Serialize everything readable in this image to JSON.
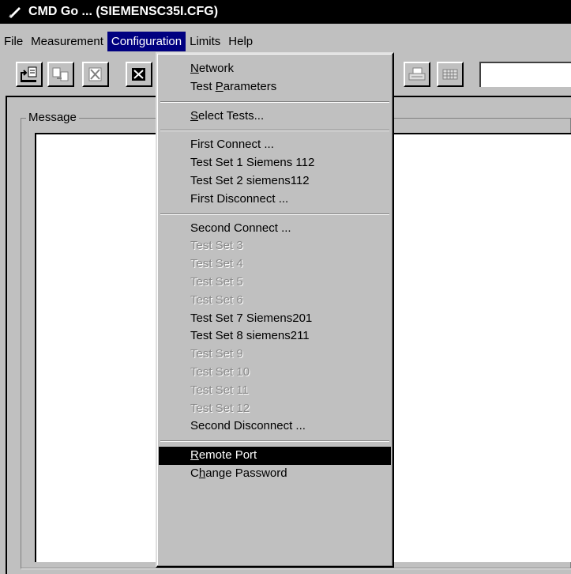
{
  "window": {
    "title": "CMD Go ... (SIEMENSC35I.CFG)"
  },
  "menubar": {
    "items": [
      {
        "label": "File"
      },
      {
        "label": "Measurement"
      },
      {
        "label": "Configuration"
      },
      {
        "label": "Limits"
      },
      {
        "label": "Help"
      }
    ]
  },
  "message_group": {
    "label": "Message"
  },
  "config_menu": {
    "network": {
      "pre": "",
      "key": "N",
      "post": "etwork"
    },
    "test_parameters": {
      "pre": "Test ",
      "key": "P",
      "post": "arameters"
    },
    "select_tests": {
      "pre": "",
      "key": "S",
      "post": "elect Tests..."
    },
    "first_connect": "First Connect  ...",
    "test_set_1": "Test Set  1  Siemens 112",
    "test_set_2": "Test Set  2  siemens112",
    "first_disconnect": "First Disconnect ...",
    "second_connect": "Second Connect ...",
    "test_set_3": "Test Set  3",
    "test_set_4": "Test Set  4",
    "test_set_5": "Test Set  5",
    "test_set_6": "Test Set  6",
    "test_set_7": "Test Set  7  Siemens201",
    "test_set_8": "Test Set  8  siemens211",
    "test_set_9": "Test Set  9",
    "test_set_10": "Test Set 10",
    "test_set_11": "Test Set 11",
    "test_set_12": "Test Set 12",
    "second_disconnect": "Second Disconnect ...",
    "remote_port": {
      "pre": "",
      "key": "R",
      "post": "emote Port"
    },
    "change_password": {
      "pre": "C",
      "key": "h",
      "post": "ange Password"
    }
  },
  "colors": {
    "menu_highlight": "#000080",
    "selected_item": "#000000",
    "title_bar": "#000000"
  },
  "icons": [
    "app-icon",
    "open-config-icon",
    "copy-test-icon",
    "delete-icon",
    "stop-icon",
    "print-icon",
    "grid-icon"
  ]
}
